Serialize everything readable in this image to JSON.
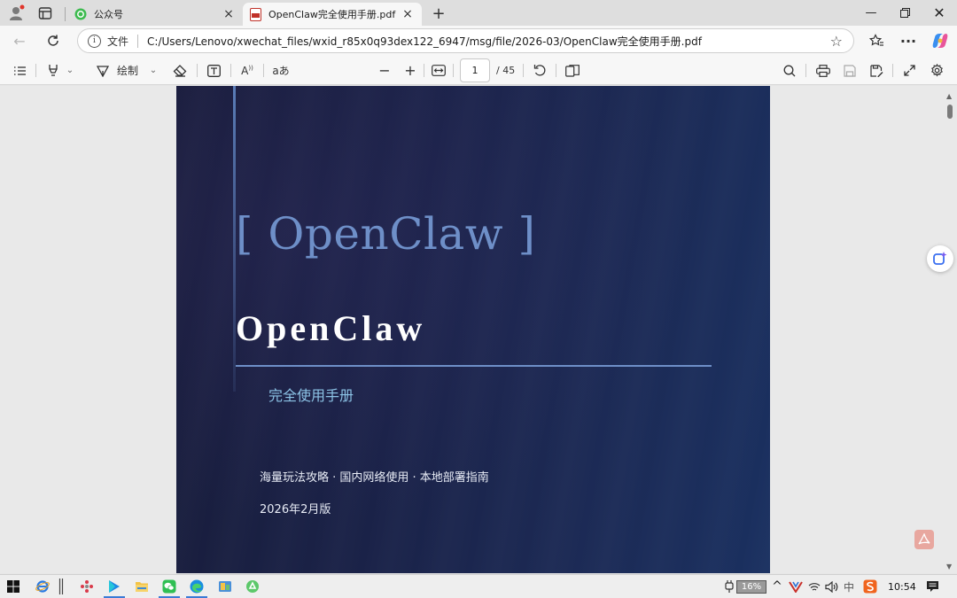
{
  "browser": {
    "tabs": [
      {
        "title": "公众号",
        "active": false
      },
      {
        "title": "OpenClaw完全使用手册.pdf",
        "active": true
      }
    ],
    "address": {
      "scheme_label": "文件",
      "url": "C:/Users/Lenovo/xwechat_files/wxid_r85x0q93dex122_6947/msg/file/2026-03/OpenClaw完全使用手册.pdf"
    }
  },
  "pdf_toolbar": {
    "draw_label": "绘制",
    "read_aloud_glyph": "aあ",
    "page_current": "1",
    "page_total": "/ 45"
  },
  "document": {
    "bracket_title": "[ OpenClaw ]",
    "main_title": "OpenClaw",
    "subtitle": "完全使用手册",
    "tagline": "海量玩法攻略 · 国内网络使用 · 本地部署指南",
    "edition": "2026年2月版"
  },
  "taskbar": {
    "battery_percent": "16%",
    "ime_label": "中",
    "clock": "10:54"
  },
  "colors": {
    "page_dark": "#181c3a",
    "page_blue": "#1a3060",
    "accent_title": "#6e8fc8",
    "subtitle_cyan": "#8cc3e6"
  }
}
